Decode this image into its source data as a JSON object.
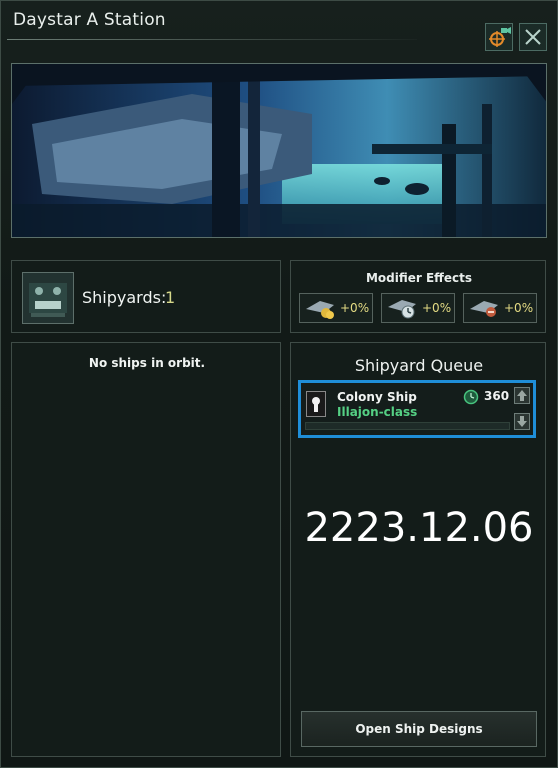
{
  "window": {
    "title": "Daystar A Station"
  },
  "titlebar": {
    "locate_icon": "crosshair-camera-icon",
    "close_icon": "close-icon"
  },
  "banner": {
    "description_icon": "station-hangar-image"
  },
  "shipyards": {
    "label": "Shipyards:",
    "count": "1",
    "icon": "shipyard-icon"
  },
  "modifiers": {
    "title": "Modifier Effects",
    "items": [
      {
        "icon": "ship-cost-icon",
        "value": "+0%"
      },
      {
        "icon": "ship-build-speed-icon",
        "value": "+0%"
      },
      {
        "icon": "ship-upkeep-icon",
        "value": "+0%"
      }
    ]
  },
  "orbit": {
    "empty_text": "No ships in orbit."
  },
  "queue": {
    "title": "Shipyard Queue",
    "item": {
      "name": "Colony Ship",
      "class": "Illajon-class",
      "time": "360",
      "progress": 0,
      "flag_icon": "empire-flag-icon",
      "clock_icon": "clock-icon"
    },
    "highlight_color": "#1f8ed8"
  },
  "date": "2223.12.06",
  "open_button": "Open Ship Designs"
}
